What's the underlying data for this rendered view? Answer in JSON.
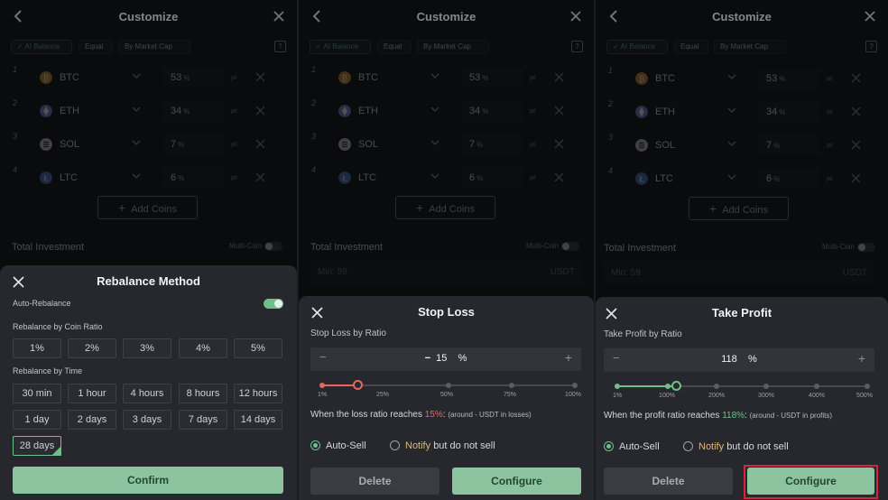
{
  "colors": {
    "accent_green": "#6ec08a",
    "loss_red": "#e3685f",
    "notify_yellow": "#e1b86a",
    "highlight": "#d6243a"
  },
  "header": {
    "title": "Customize",
    "back_icon": "chevron-left-icon",
    "close_icon": "close-icon"
  },
  "modes": [
    "✓ AI Balance",
    "Equal",
    "By Market Cap"
  ],
  "help_label": "?",
  "coins": [
    {
      "num": "1",
      "name": "BTC",
      "pct": "53",
      "color": "#d1913a",
      "glyph": "₿"
    },
    {
      "num": "2",
      "name": "ETH",
      "pct": "34",
      "color": "#7b86d6",
      "glyph": "◆"
    },
    {
      "num": "3",
      "name": "SOL",
      "pct": "7",
      "color": "#c9c9c9",
      "glyph": "≡"
    },
    {
      "num": "4",
      "name": "LTC",
      "pct": "6",
      "color": "#4f74c6",
      "glyph": "Ł"
    }
  ],
  "pct_unit": "%",
  "lock_symbol": "≓",
  "add_coins": "Add Coins",
  "total_investment": "Total Investment",
  "multi_coin": "Multi-Coin",
  "min_placeholder": "Min: 59",
  "currency": "USDT",
  "rebalance": {
    "title": "Rebalance Method",
    "auto_label": "Auto-Rebalance",
    "auto_on": true,
    "ratio_label": "Rebalance by Coin Ratio",
    "ratios": [
      "1%",
      "2%",
      "3%",
      "4%",
      "5%"
    ],
    "time_label": "Rebalance by Time",
    "times": [
      "30 min",
      "1 hour",
      "4 hours",
      "8 hours",
      "12 hours",
      "1 day",
      "2 days",
      "3 days",
      "7 days",
      "14 days",
      "28 days"
    ],
    "selected_time": "28 days",
    "confirm": "Confirm"
  },
  "stop_loss": {
    "title": "Stop Loss",
    "ratio_label": "Stop Loss by Ratio",
    "value": "15",
    "unit": "%",
    "slider_ticks": [
      "1%",
      "25%",
      "50%",
      "75%",
      "100%"
    ],
    "slider_fraction": 0.14,
    "desc_pre": "When the loss ratio reaches ",
    "desc_val": "15%",
    "desc_post": ":",
    "desc_small": "(around - USDT in losses)",
    "auto_sell": "Auto-Sell",
    "notify": "Notify",
    "notify_rest": "but do not sell",
    "delete": "Delete",
    "configure": "Configure"
  },
  "take_profit": {
    "title": "Take Profit",
    "ratio_label": "Take Profit by Ratio",
    "value": "118",
    "unit": "%",
    "slider_ticks": [
      "1%",
      "100%",
      "200%",
      "300%",
      "400%",
      "500%"
    ],
    "slider_fraction": 0.236,
    "desc_pre": "When the profit ratio reaches ",
    "desc_val": "118%",
    "desc_post": ":",
    "desc_small": "(around - USDT in profits)",
    "auto_sell": "Auto-Sell",
    "notify": "Notify",
    "notify_rest": "but do not sell",
    "delete": "Delete",
    "configure": "Configure"
  }
}
